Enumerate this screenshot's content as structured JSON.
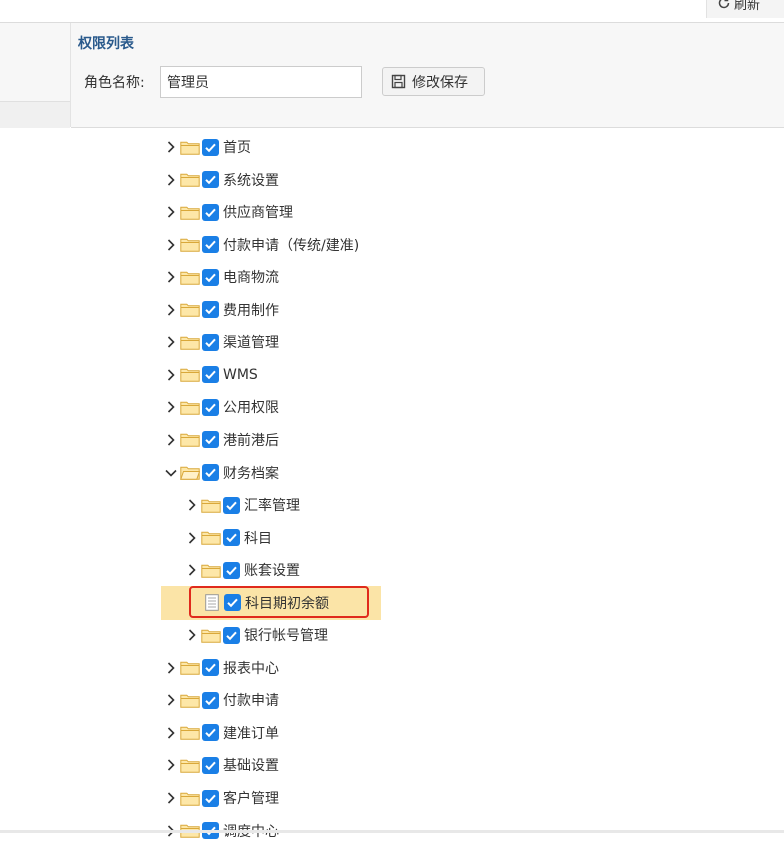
{
  "toolbar": {
    "refresh_label": "刷新"
  },
  "panel": {
    "title": "权限列表",
    "role_label": "角色名称:",
    "role_value": "管理员",
    "save_label": "修改保存"
  },
  "tree": {
    "items": [
      {
        "label": "首页",
        "level": 0,
        "type": "folder",
        "expanded": false,
        "checked": true
      },
      {
        "label": "系统设置",
        "level": 0,
        "type": "folder",
        "expanded": false,
        "checked": true
      },
      {
        "label": "供应商管理",
        "level": 0,
        "type": "folder",
        "expanded": false,
        "checked": true
      },
      {
        "label": "付款申请（传统/建准)",
        "level": 0,
        "type": "folder",
        "expanded": false,
        "checked": true
      },
      {
        "label": "电商物流",
        "level": 0,
        "type": "folder",
        "expanded": false,
        "checked": true
      },
      {
        "label": "费用制作",
        "level": 0,
        "type": "folder",
        "expanded": false,
        "checked": true
      },
      {
        "label": "渠道管理",
        "level": 0,
        "type": "folder",
        "expanded": false,
        "checked": true
      },
      {
        "label": "WMS",
        "level": 0,
        "type": "folder",
        "expanded": false,
        "checked": true
      },
      {
        "label": "公用权限",
        "level": 0,
        "type": "folder",
        "expanded": false,
        "checked": true
      },
      {
        "label": "港前港后",
        "level": 0,
        "type": "folder",
        "expanded": false,
        "checked": true
      },
      {
        "label": "财务档案",
        "level": 0,
        "type": "folder",
        "expanded": true,
        "checked": true
      },
      {
        "label": "汇率管理",
        "level": 1,
        "type": "folder",
        "expanded": false,
        "checked": true
      },
      {
        "label": "科目",
        "level": 1,
        "type": "folder",
        "expanded": false,
        "checked": true
      },
      {
        "label": "账套设置",
        "level": 1,
        "type": "folder",
        "expanded": false,
        "checked": true
      },
      {
        "label": "科目期初余额",
        "level": 1,
        "type": "file",
        "expanded": false,
        "checked": true,
        "selected": true
      },
      {
        "label": "银行帐号管理",
        "level": 1,
        "type": "folder",
        "expanded": false,
        "checked": true
      },
      {
        "label": "报表中心",
        "level": 0,
        "type": "folder",
        "expanded": false,
        "checked": true
      },
      {
        "label": "付款申请",
        "level": 0,
        "type": "folder",
        "expanded": false,
        "checked": true
      },
      {
        "label": "建准订单",
        "level": 0,
        "type": "folder",
        "expanded": false,
        "checked": true
      },
      {
        "label": "基础设置",
        "level": 0,
        "type": "folder",
        "expanded": false,
        "checked": true
      },
      {
        "label": "客户管理",
        "level": 0,
        "type": "folder",
        "expanded": false,
        "checked": true
      },
      {
        "label": "调度中心",
        "level": 0,
        "type": "folder",
        "expanded": false,
        "checked": true
      }
    ]
  },
  "colors": {
    "accent": "#1a7fe6",
    "highlight": "#fbe4a7",
    "selection_border": "#e02a1c",
    "title": "#2a5a8c"
  }
}
